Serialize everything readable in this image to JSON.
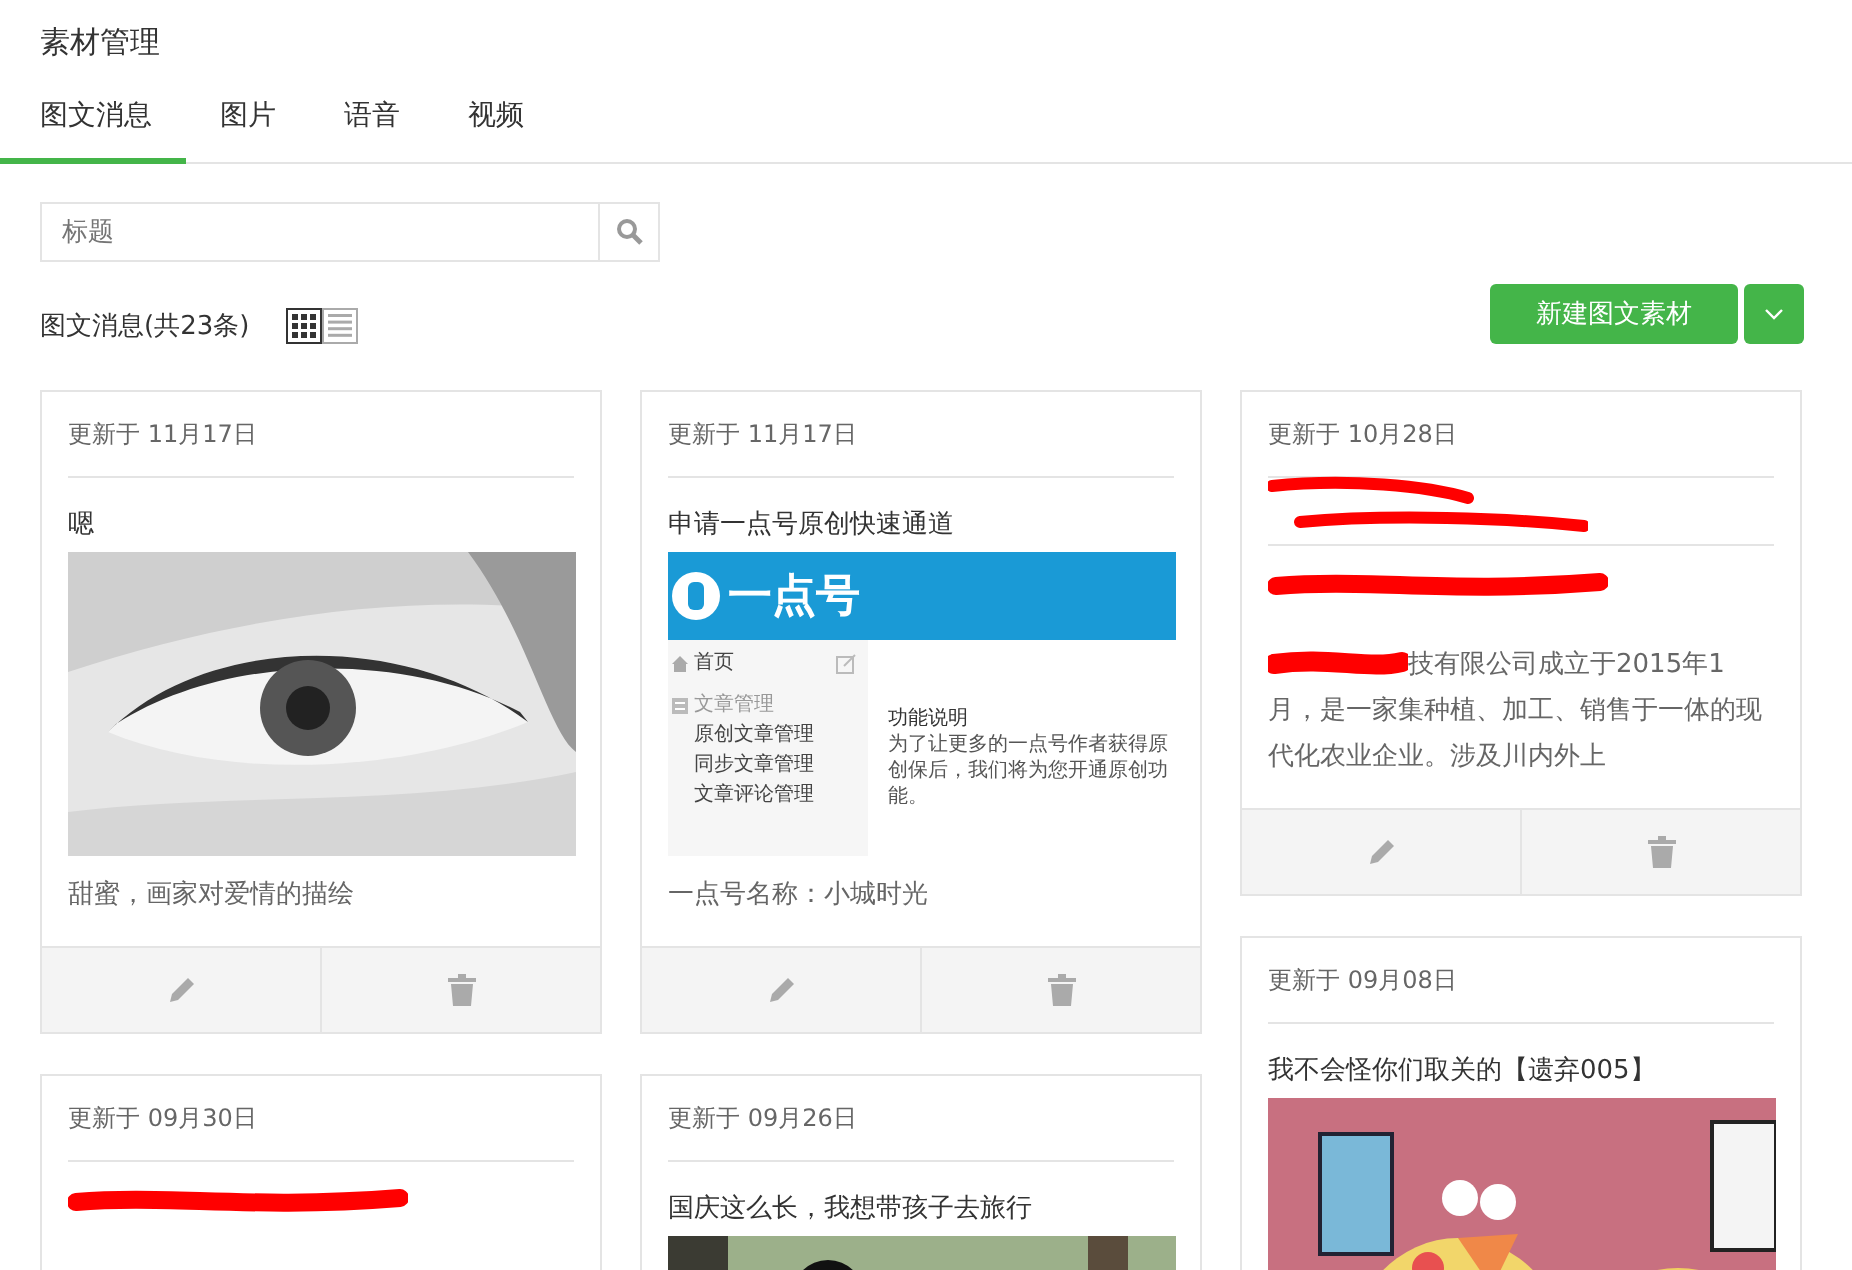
{
  "header": {
    "title": "素材管理"
  },
  "tabs": [
    {
      "label": "图文消息",
      "selected": true
    },
    {
      "label": "图片",
      "selected": false
    },
    {
      "label": "语音",
      "selected": false
    },
    {
      "label": "视频",
      "selected": false
    }
  ],
  "search": {
    "placeholder": "标题"
  },
  "summary": {
    "count_label": "图文消息(共23条)",
    "views": [
      {
        "kind": "grid",
        "selected": true
      },
      {
        "kind": "list",
        "selected": false
      }
    ]
  },
  "new_button": {
    "label": "新建图文素材"
  },
  "columns": [
    {
      "cards": [
        {
          "date": "更新于 11月17日",
          "title": "嗯",
          "kind": "picture",
          "description": "甜蜜，画家对爱情的描绘",
          "footer": true
        },
        {
          "date": "更新于 09月30日",
          "title_redacted": true,
          "footer": false
        }
      ]
    },
    {
      "cards": [
        {
          "date": "更新于 11月17日",
          "title": "申请一点号原创快速通道",
          "kind": "screenshot",
          "screenshot": {
            "logo": "一点号",
            "nav": [
              {
                "kind": "home",
                "label": "首页"
              },
              {
                "kind": "section",
                "label": "文章管理"
              },
              {
                "kind": "item",
                "label": "原创文章管理"
              },
              {
                "kind": "item",
                "label": "同步文章管理"
              },
              {
                "kind": "item",
                "label": "文章评论管理"
              }
            ],
            "heading": "功能说明",
            "text": "为了让更多的一点号作者获得原创保后，我们将为您开通原创功能。"
          },
          "description": "一点号名称：小城时光",
          "footer": true
        },
        {
          "date": "更新于 09月26日",
          "title": "国庆这么长，我想带孩子去旅行",
          "kind": "picture",
          "footer": false
        }
      ]
    },
    {
      "cards": [
        {
          "date": "更新于 10月28日",
          "notice_redacted": true,
          "title_redacted": true,
          "description_prefix_redacted": true,
          "description": "技有限公司成立于2015年1月，是一家集种植、加工、销售于一体的现代化农业企业。涉及川内外上",
          "footer": true
        },
        {
          "date": "更新于 09月08日",
          "title": "我不会怪你们取关的【遗弃005】",
          "kind": "picture",
          "footer": false
        }
      ]
    }
  ]
}
